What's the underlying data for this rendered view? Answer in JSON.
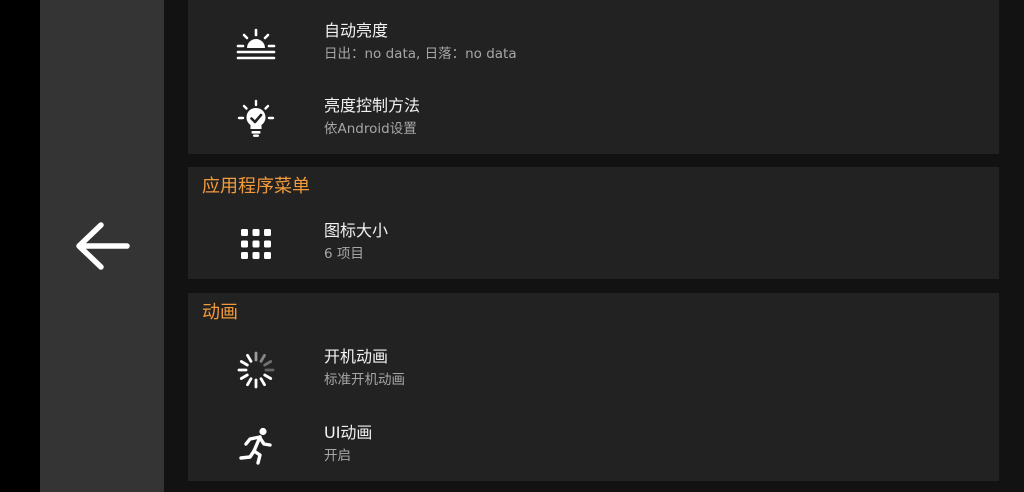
{
  "nav": {
    "back_icon": "arrow-left-icon"
  },
  "display_section": {
    "items": [
      {
        "icon": "sunrise-icon",
        "title": "自动亮度",
        "subtitle": "日出：no data, 日落：no data"
      },
      {
        "icon": "bulb-check-icon",
        "title": "亮度控制方法",
        "subtitle": "依Android设置"
      }
    ]
  },
  "app_menu_section": {
    "title": "应用程序菜单",
    "items": [
      {
        "icon": "grid-icon",
        "title": "图标大小",
        "subtitle": "6 项目"
      }
    ]
  },
  "animation_section": {
    "title": "动画",
    "items": [
      {
        "icon": "spinner-icon",
        "title": "开机动画",
        "subtitle": "标准开机动画"
      },
      {
        "icon": "running-person-icon",
        "title": "UI动画",
        "subtitle": "开启"
      }
    ]
  },
  "colors": {
    "accent": "#f39a3b",
    "card_bg": "#222222",
    "rail_bg": "#343434"
  }
}
